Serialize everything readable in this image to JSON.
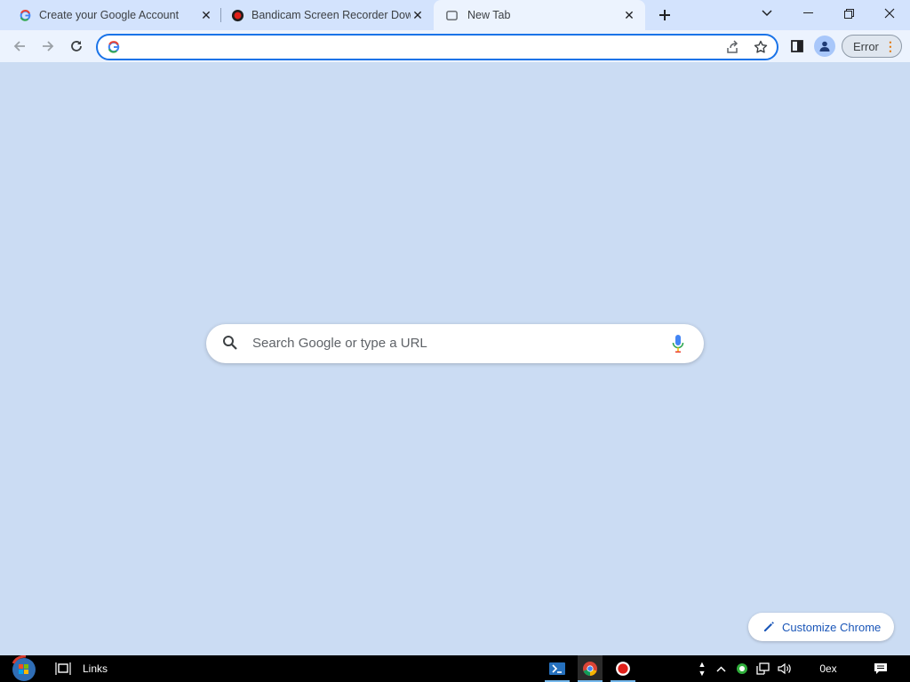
{
  "tabs": [
    {
      "title": "Create your Google Account",
      "favicon": "google-g-icon",
      "active": false
    },
    {
      "title": "Bandicam Screen Recorder Download",
      "favicon": "bandicam-record-icon",
      "active": false
    },
    {
      "title": "New Tab",
      "favicon": "new-tab-icon",
      "active": true
    }
  ],
  "toolbar": {
    "omnibox_value": "",
    "profile_error_label": "Error"
  },
  "ntp": {
    "search_placeholder": "Search Google or type a URL",
    "customize_label": "Customize Chrome"
  },
  "taskbar": {
    "links_label": "Links",
    "clock_text": "0ex"
  },
  "colors": {
    "page_background": "#cbdcf3",
    "tabstrip": "#d3e3fd",
    "toolbar": "#ecf3fe",
    "accent": "#1a73e8",
    "taskbar": "#000000"
  }
}
